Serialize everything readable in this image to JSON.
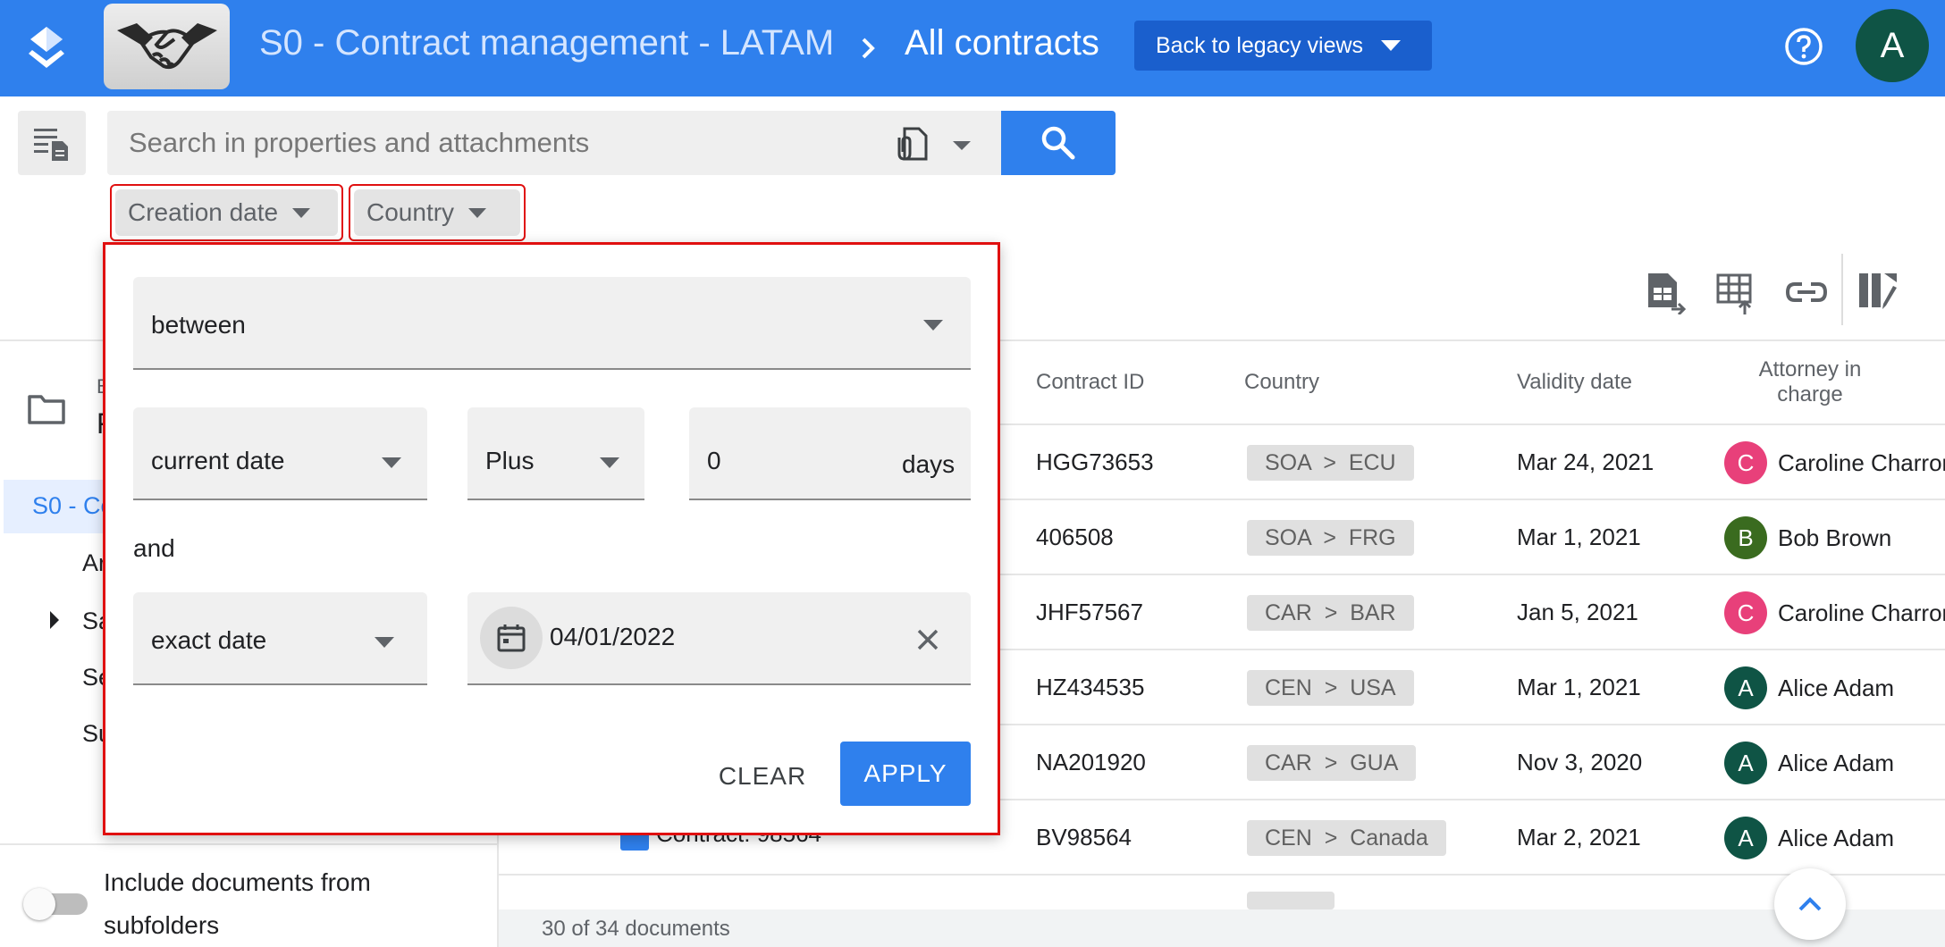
{
  "header": {
    "folder_title": "S0 - Contract management - LATAM",
    "current_view": "All contracts",
    "legacy_button": "Back to legacy views",
    "user_initial": "A"
  },
  "search": {
    "placeholder": "Search in properties and attachments"
  },
  "filters": {
    "creation_date": "Creation date",
    "country": "Country"
  },
  "date_filter": {
    "operator": "between",
    "from_reference": "current date",
    "from_modifier": "Plus",
    "from_amount": "0",
    "from_unit": "days",
    "and_label": "and",
    "to_reference": "exact date",
    "to_date": "04/01/2022",
    "clear_label": "CLEAR",
    "apply_label": "APPLY"
  },
  "sidebar": {
    "header_frag_1": "B",
    "header_frag_2": "F",
    "selected_item": "S0 - Co",
    "items": [
      "Ar",
      "Sa",
      "Se",
      "Su"
    ],
    "include_subfolders": "Include documents from subfolders"
  },
  "table": {
    "columns": [
      "Contract ID",
      "Country",
      "Validity date",
      "Attorney in\ncharge"
    ],
    "rows": [
      {
        "contract_id": "HGG73653",
        "region": "SOA",
        "country": "ECU",
        "validity": "Mar 24, 2021",
        "attorney_initial": "C",
        "attorney": "Caroline Charron",
        "color": "#e8407a"
      },
      {
        "contract_id": "406508",
        "region": "SOA",
        "country": "FRG",
        "validity": "Mar 1, 2021",
        "attorney_initial": "B",
        "attorney": "Bob Brown",
        "color": "#3a6b1f"
      },
      {
        "contract_id": "JHF57567",
        "region": "CAR",
        "country": "BAR",
        "validity": "Jan 5, 2021",
        "attorney_initial": "C",
        "attorney": "Caroline Charron",
        "color": "#e8407a"
      },
      {
        "contract_id": "HZ434535",
        "region": "CEN",
        "country": "USA",
        "validity": "Mar 1, 2021",
        "attorney_initial": "A",
        "attorney": "Alice Adam",
        "color": "#0f5445"
      },
      {
        "contract_id": "NA201920",
        "region": "CAR",
        "country": "GUA",
        "validity": "Nov 3, 2020",
        "attorney_initial": "A",
        "attorney": "Alice Adam",
        "color": "#0f5445"
      },
      {
        "contract_id": "BV98564",
        "region": "CEN",
        "country": "Canada",
        "validity": "Mar 2, 2021",
        "attorney_initial": "A",
        "attorney": "Alice Adam",
        "color": "#0f5445"
      }
    ],
    "partial_doc_title": "Contract: 98564",
    "footer_count": "30 of 34 documents"
  },
  "colors": {
    "primary": "#2f80ed",
    "primary_dark": "#1a5fcd",
    "highlight_border": "#e01010",
    "avatar": "#0f5445"
  }
}
